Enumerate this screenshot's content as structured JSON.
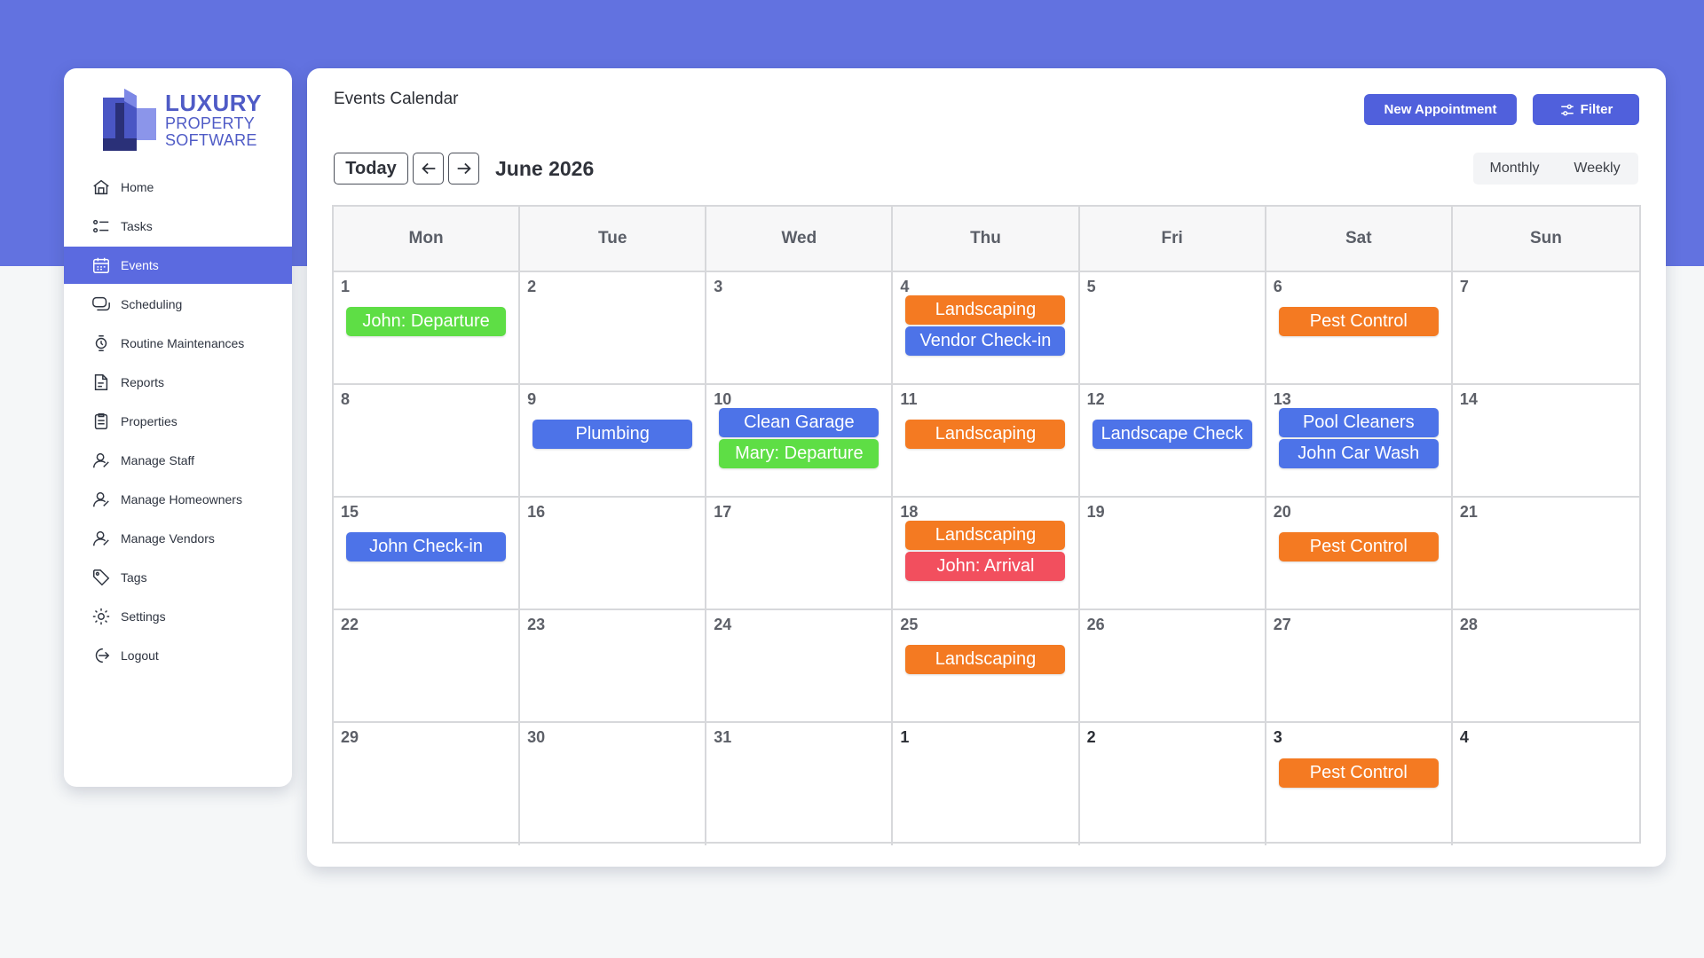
{
  "brand": {
    "line1": "LUXURY",
    "line2": "PROPERTY",
    "line3": "SOFTWARE"
  },
  "sidebar": {
    "items": [
      {
        "label": "Home",
        "icon": "home-icon"
      },
      {
        "label": "Tasks",
        "icon": "tasks-icon"
      },
      {
        "label": "Events",
        "icon": "calendar-icon",
        "active": true
      },
      {
        "label": "Scheduling",
        "icon": "scheduling-icon"
      },
      {
        "label": "Routine Maintenances",
        "icon": "maintenance-icon"
      },
      {
        "label": "Reports",
        "icon": "reports-icon"
      },
      {
        "label": "Properties",
        "icon": "properties-icon"
      },
      {
        "label": "Manage Staff",
        "icon": "user-icon"
      },
      {
        "label": "Manage Homeowners",
        "icon": "user-icon"
      },
      {
        "label": "Manage Vendors",
        "icon": "user-icon"
      },
      {
        "label": "Tags",
        "icon": "tag-icon"
      },
      {
        "label": "Settings",
        "icon": "gear-icon"
      },
      {
        "label": "Logout",
        "icon": "logout-icon"
      }
    ]
  },
  "header": {
    "title": "Events Calendar",
    "new_appointment": "New Appointment",
    "filter": "Filter"
  },
  "toolbar": {
    "today": "Today",
    "month_label": "June 2026",
    "monthly": "Monthly",
    "weekly": "Weekly"
  },
  "calendar": {
    "days_of_week": [
      "Mon",
      "Tue",
      "Wed",
      "Thu",
      "Fri",
      "Sat",
      "Sun"
    ],
    "weeks": [
      [
        {
          "day": "1",
          "events": [
            {
              "label": "John: Departure",
              "type": "green"
            }
          ]
        },
        {
          "day": "2",
          "events": []
        },
        {
          "day": "3",
          "events": []
        },
        {
          "day": "4",
          "events": [
            {
              "label": "Landscaping",
              "type": "orange"
            },
            {
              "label": "Vendor Check-in",
              "type": "blue"
            }
          ]
        },
        {
          "day": "5",
          "events": []
        },
        {
          "day": "6",
          "events": [
            {
              "label": "Pest Control",
              "type": "orange"
            }
          ]
        },
        {
          "day": "7",
          "events": []
        }
      ],
      [
        {
          "day": "8",
          "events": []
        },
        {
          "day": "9",
          "events": [
            {
              "label": "Plumbing",
              "type": "blue"
            }
          ]
        },
        {
          "day": "10",
          "events": [
            {
              "label": "Clean Garage",
              "type": "blue"
            },
            {
              "label": "Mary: Departure",
              "type": "green"
            }
          ]
        },
        {
          "day": "11",
          "events": [
            {
              "label": "Landscaping",
              "type": "orange"
            }
          ]
        },
        {
          "day": "12",
          "events": [
            {
              "label": "Landscape Check",
              "type": "blue"
            }
          ]
        },
        {
          "day": "13",
          "events": [
            {
              "label": "Pool Cleaners",
              "type": "blue"
            },
            {
              "label": "John Car Wash",
              "type": "blue"
            }
          ]
        },
        {
          "day": "14",
          "events": []
        }
      ],
      [
        {
          "day": "15",
          "events": [
            {
              "label": "John Check-in",
              "type": "blue"
            }
          ]
        },
        {
          "day": "16",
          "events": []
        },
        {
          "day": "17",
          "events": []
        },
        {
          "day": "18",
          "events": [
            {
              "label": "Landscaping",
              "type": "orange"
            },
            {
              "label": "John: Arrival",
              "type": "red"
            }
          ]
        },
        {
          "day": "19",
          "events": []
        },
        {
          "day": "20",
          "events": [
            {
              "label": "Pest Control",
              "type": "orange"
            }
          ]
        },
        {
          "day": "21",
          "events": []
        }
      ],
      [
        {
          "day": "22",
          "events": []
        },
        {
          "day": "23",
          "events": []
        },
        {
          "day": "24",
          "events": []
        },
        {
          "day": "25",
          "events": [
            {
              "label": "Landscaping",
              "type": "orange"
            }
          ]
        },
        {
          "day": "26",
          "events": []
        },
        {
          "day": "27",
          "events": []
        },
        {
          "day": "28",
          "events": []
        }
      ],
      [
        {
          "day": "29",
          "events": []
        },
        {
          "day": "30",
          "events": []
        },
        {
          "day": "31",
          "events": []
        },
        {
          "day": "1",
          "other": true,
          "events": []
        },
        {
          "day": "2",
          "other": true,
          "events": []
        },
        {
          "day": "3",
          "other": true,
          "events": [
            {
              "label": "Pest Control",
              "type": "orange"
            }
          ]
        },
        {
          "day": "4",
          "other": true,
          "events": []
        }
      ]
    ]
  },
  "colors": {
    "band": "#6272e0",
    "accent": "#5060dc",
    "orange": "#f47a22",
    "blue": "#4d73e8",
    "green": "#5ede45",
    "red": "#f24f5e"
  }
}
